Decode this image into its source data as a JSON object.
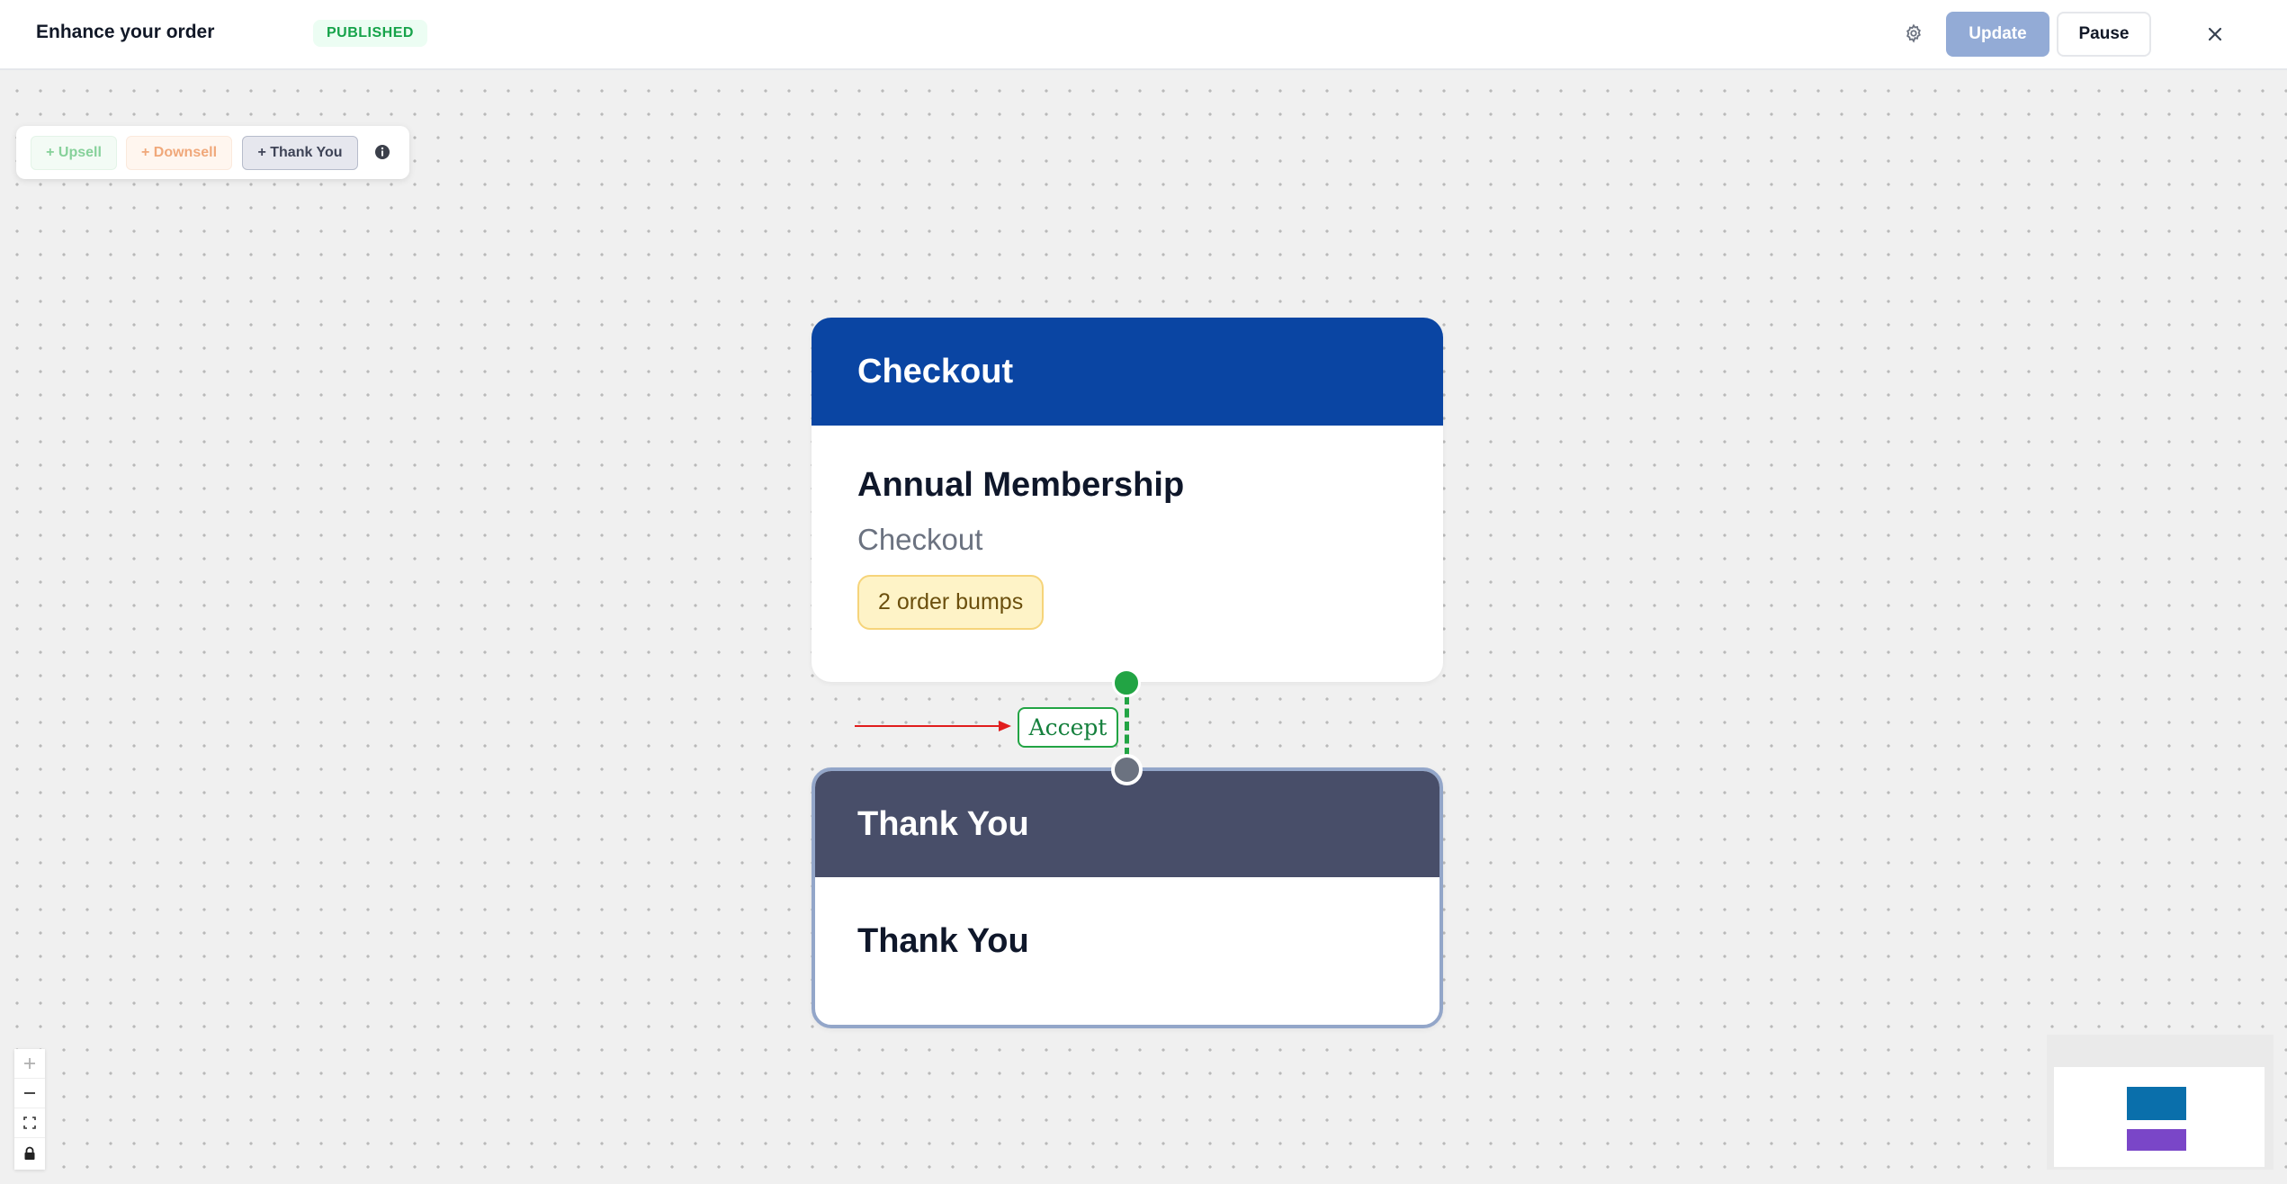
{
  "header": {
    "title": "Enhance your order",
    "status": "PUBLISHED",
    "settings_icon": "gear-icon",
    "update_label": "Update",
    "pause_label": "Pause",
    "close_icon": "close-icon"
  },
  "add_toolbar": {
    "upsell": "+ Upsell",
    "downsell": "+ Downsell",
    "thank_you": "+ Thank You",
    "info_icon": "info-icon"
  },
  "nodes": {
    "checkout": {
      "header": "Checkout",
      "name": "Annual Membership",
      "type": "Checkout",
      "badge": "2 order bumps",
      "header_color": "#0a45a3"
    },
    "thank_you": {
      "header": "Thank You",
      "name": "Thank You",
      "header_color": "#484e69"
    }
  },
  "edge": {
    "label": "Accept",
    "color": "#22a444"
  },
  "zoom_controls": [
    "zoom-in-icon",
    "zoom-out-icon",
    "fit-view-icon",
    "lock-icon"
  ],
  "minimap": {
    "node_colors": [
      "#0a6fab",
      "#7a46c8"
    ]
  }
}
